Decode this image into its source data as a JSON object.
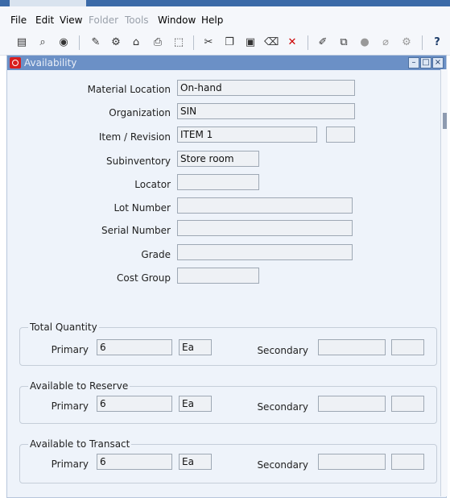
{
  "menu": [
    {
      "id": "file",
      "label": "File",
      "enabled": true
    },
    {
      "id": "edit",
      "label": "Edit",
      "enabled": true
    },
    {
      "id": "view",
      "label": "View",
      "enabled": true
    },
    {
      "id": "folder",
      "label": "Folder",
      "enabled": false
    },
    {
      "id": "tools",
      "label": "Tools",
      "enabled": false
    },
    {
      "id": "window",
      "label": "Window",
      "enabled": true
    },
    {
      "id": "help",
      "label": "Help",
      "enabled": true
    }
  ],
  "window": {
    "title": "Availability"
  },
  "form": {
    "material_location": {
      "label": "Material Location",
      "value": "On-hand"
    },
    "organization": {
      "label": "Organization",
      "value": "SIN"
    },
    "item_revision": {
      "label": "Item / Revision",
      "item": "ITEM 1",
      "revision": ""
    },
    "subinventory": {
      "label": "Subinventory",
      "value": "Store room"
    },
    "locator": {
      "label": "Locator",
      "value": ""
    },
    "lot_number": {
      "label": "Lot Number",
      "value": ""
    },
    "serial_number": {
      "label": "Serial Number",
      "value": ""
    },
    "grade": {
      "label": "Grade",
      "value": ""
    },
    "cost_group": {
      "label": "Cost Group",
      "value": ""
    }
  },
  "groups": [
    {
      "title": "Total Quantity",
      "primary_label": "Primary",
      "primary_value": "6",
      "primary_uom": "Ea",
      "secondary_label": "Secondary",
      "secondary_value": "",
      "secondary_uom": ""
    },
    {
      "title": "Available to Reserve",
      "primary_label": "Primary",
      "primary_value": "6",
      "primary_uom": "Ea",
      "secondary_label": "Secondary",
      "secondary_value": "",
      "secondary_uom": ""
    },
    {
      "title": "Available to Transact",
      "primary_label": "Primary",
      "primary_value": "6",
      "primary_uom": "Ea",
      "secondary_label": "Secondary",
      "secondary_value": "",
      "secondary_uom": ""
    }
  ]
}
